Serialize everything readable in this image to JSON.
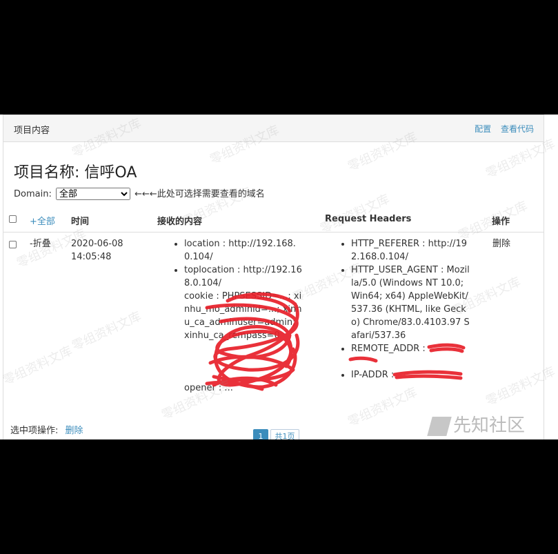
{
  "panel": {
    "title": "项目内容",
    "config_link": "配置",
    "view_code_link": "查看代码"
  },
  "project": {
    "heading": "项目名称: 信呼OA",
    "domain_label": "Domain:",
    "domain_selected": "全部",
    "domain_hint": "←←←此处可选择需要查看的域名"
  },
  "table": {
    "headers": {
      "all": "+全部",
      "time": "时间",
      "content": "接收的内容",
      "request_headers": "Request Headers",
      "action": "操作"
    },
    "rows": [
      {
        "toggle": "-折叠",
        "date": "2020-06-08",
        "time": "14:05:48",
        "content": [
          "location : http://192.168.0.104/",
          "toplocation : http://192.168.0.104/",
          "cookie : PHPSESSID=...; xinhu_mo_adminid=...; xinhu_ca_adminuser=admin; xinhu_ca_rempass=0",
          "opener : ..."
        ],
        "headers": [
          "HTTP_REFERER : http://192.168.0.104/",
          "HTTP_USER_AGENT : Mozilla/5.0 (Windows NT 10.0; Win64; x64) AppleWebKit/537.36 (KHTML, like Gecko) Chrome/83.0.4103.97 Safari/537.36",
          "REMOTE_ADDR : ",
          "IP-ADDR : "
        ],
        "delete": "删除"
      }
    ]
  },
  "pagination": {
    "current": "1",
    "total": "共1页"
  },
  "footer": {
    "selected_label": "选中项操作:",
    "delete": "删除"
  },
  "watermark": {
    "text": "零组资料文库",
    "logo_text": "先知社区"
  },
  "colors": {
    "link": "#3c8dbc",
    "redaction": "#e8202a"
  }
}
